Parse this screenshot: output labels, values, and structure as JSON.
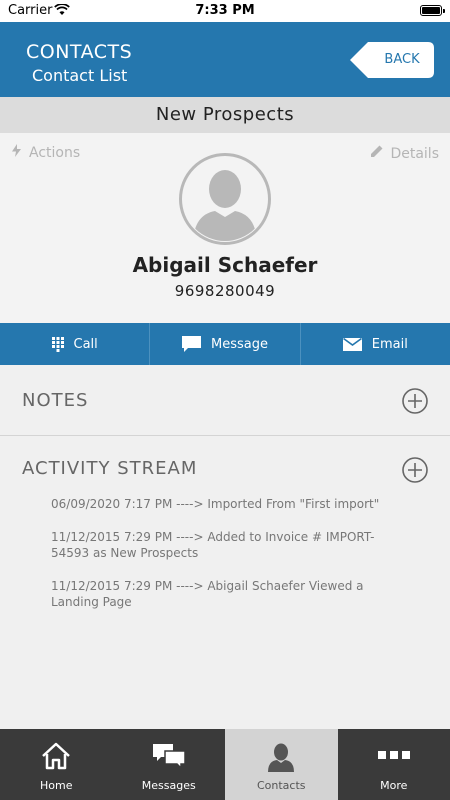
{
  "status_bar": {
    "carrier": "Carrier",
    "time": "7:33 PM"
  },
  "header": {
    "title": "CONTACTS",
    "subtitle": "Contact List",
    "back_label": "BACK"
  },
  "banner": {
    "title": "New Prospects"
  },
  "profile": {
    "actions_label": "Actions",
    "details_label": "Details",
    "name": "Abigail Schaefer",
    "phone": "9698280049"
  },
  "action_bar": {
    "call": "Call",
    "message": "Message",
    "email": "Email"
  },
  "notes": {
    "title": "NOTES"
  },
  "activity": {
    "title": "ACTIVITY STREAM",
    "items": [
      "06/09/2020 7:17 PM ----> Imported From \"First import\"",
      "11/12/2015 7:29 PM ----> Added to Invoice # IMPORT-54593 as New Prospects",
      "11/12/2015 7:29 PM ----> Abigail Schaefer Viewed a Landing Page"
    ]
  },
  "tabs": [
    {
      "label": "Home",
      "icon": "home-icon"
    },
    {
      "label": "Messages",
      "icon": "messages-icon"
    },
    {
      "label": "Contacts",
      "icon": "contacts-icon",
      "active": true
    },
    {
      "label": "More",
      "icon": "more-icon"
    }
  ],
  "colors": {
    "brand_blue": "#2577ae",
    "tab_bar": "#3a3a3a",
    "active_tab": "#d3d3d3"
  }
}
